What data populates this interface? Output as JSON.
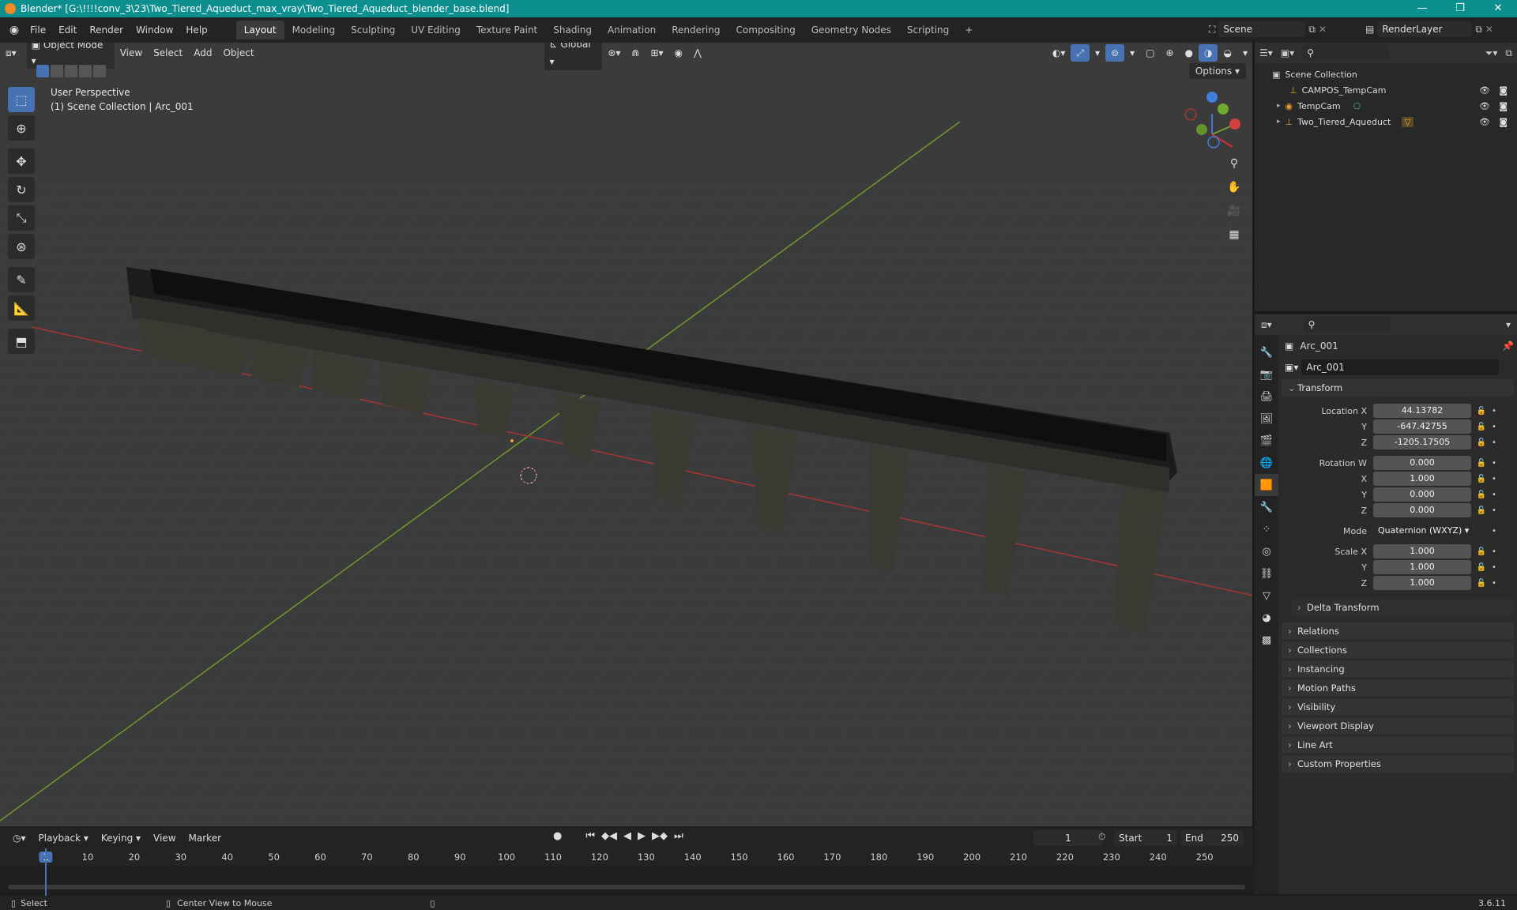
{
  "window": {
    "title": "Blender* [G:\\!!!!conv_3\\23\\Two_Tiered_Aqueduct_max_vray\\Two_Tiered_Aqueduct_blender_base.blend]",
    "minimize": "—",
    "maximize": "❐",
    "close": "✕"
  },
  "menu": {
    "file": "File",
    "edit": "Edit",
    "render": "Render",
    "window": "Window",
    "help": "Help"
  },
  "workspaces": [
    "Layout",
    "Modeling",
    "Sculpting",
    "UV Editing",
    "Texture Paint",
    "Shading",
    "Animation",
    "Rendering",
    "Compositing",
    "Geometry Nodes",
    "Scripting"
  ],
  "scene": {
    "name": "Scene",
    "view_layer": "RenderLayer"
  },
  "viewport": {
    "mode": "Object Mode",
    "menus": {
      "view": "View",
      "select": "Select",
      "add": "Add",
      "object": "Object"
    },
    "orientation": "Global",
    "options": "Options",
    "info_line1": "User Perspective",
    "info_line2": "(1) Scene Collection | Arc_001",
    "accent": "#4772b3"
  },
  "outliner": {
    "root": "Scene Collection",
    "items": [
      {
        "label": "CAMPOS_TempCam"
      },
      {
        "label": "TempCam"
      },
      {
        "label": "Two_Tiered_Aqueduct"
      }
    ]
  },
  "properties": {
    "object_name": "Arc_001",
    "data_name": "Arc_001",
    "transform_title": "Transform",
    "location": {
      "label_x": "Location X",
      "x": "44.13782",
      "y": "-647.42755",
      "z": "-1205.17505"
    },
    "rotation": {
      "label_w": "Rotation W",
      "w": "0.000",
      "x": "1.000",
      "y": "0.000",
      "z": "0.000"
    },
    "mode_label": "Mode",
    "mode_value": "Quaternion (WXYZ)",
    "scale": {
      "label_x": "Scale X",
      "x": "1.000",
      "y": "1.000",
      "z": "1.000"
    },
    "axis": {
      "x": "X",
      "y": "Y",
      "z": "Z"
    },
    "delta": "Delta Transform",
    "panels": [
      "Relations",
      "Collections",
      "Instancing",
      "Motion Paths",
      "Visibility",
      "Viewport Display",
      "Line Art",
      "Custom Properties"
    ]
  },
  "timeline": {
    "menus": {
      "playback": "Playback",
      "keying": "Keying",
      "view": "View",
      "marker": "Marker"
    },
    "current_frame": "1",
    "start_label": "Start",
    "start": "1",
    "end_label": "End",
    "end": "250",
    "ticks": [
      "1",
      "10",
      "20",
      "30",
      "40",
      "50",
      "60",
      "70",
      "80",
      "90",
      "100",
      "110",
      "120",
      "130",
      "140",
      "150",
      "160",
      "170",
      "180",
      "190",
      "200",
      "210",
      "220",
      "230",
      "240",
      "250"
    ]
  },
  "status": {
    "select": "Select",
    "center_view": "Center View to Mouse",
    "version": "3.6.11"
  }
}
